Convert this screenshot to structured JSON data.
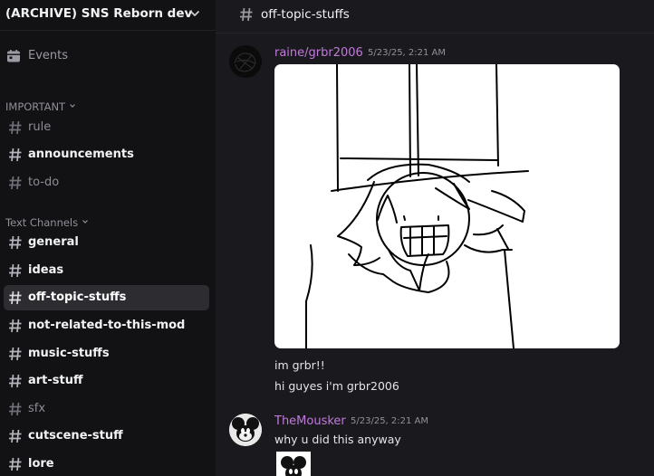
{
  "server": {
    "name": "(ARCHIVE) SNS Reborn dev"
  },
  "events": {
    "label": "Events"
  },
  "categories": [
    {
      "label": "IMPORTANT"
    },
    {
      "label": "Text Channels"
    }
  ],
  "channels_important": [
    {
      "name": "rule"
    },
    {
      "name": "announcements"
    },
    {
      "name": "to-do"
    }
  ],
  "channels_text": [
    {
      "name": "general"
    },
    {
      "name": "ideas"
    },
    {
      "name": "off-topic-stuffs"
    },
    {
      "name": "not-related-to-this-mod"
    },
    {
      "name": "music-stuffs"
    },
    {
      "name": "art-stuff"
    },
    {
      "name": "sfx"
    },
    {
      "name": "cutscene-stuff"
    },
    {
      "name": "lore"
    }
  ],
  "current_channel": "off-topic-stuffs",
  "messages": [
    {
      "author": "raine/grbr2006",
      "timestamp": "5/23/25, 2:21 AM",
      "lines": [
        "im grbr!!",
        "hi guyes i'm grbr2006"
      ]
    },
    {
      "author": "TheMousker",
      "timestamp": "5/23/25, 2:21 AM",
      "lines": [
        "why u did this anyway"
      ]
    }
  ],
  "colors": {
    "sidebar_bg": "#121214",
    "main_bg": "#1a1a1e",
    "active_channel_bg": "#2c2c31",
    "author_color": "#c27adb",
    "unread_text": "#f2f3f5",
    "read_text": "#8c8d95"
  },
  "icons": {
    "channel": "hash-icon",
    "events": "calendar-icon",
    "server_menu": "chevron-down-icon"
  }
}
